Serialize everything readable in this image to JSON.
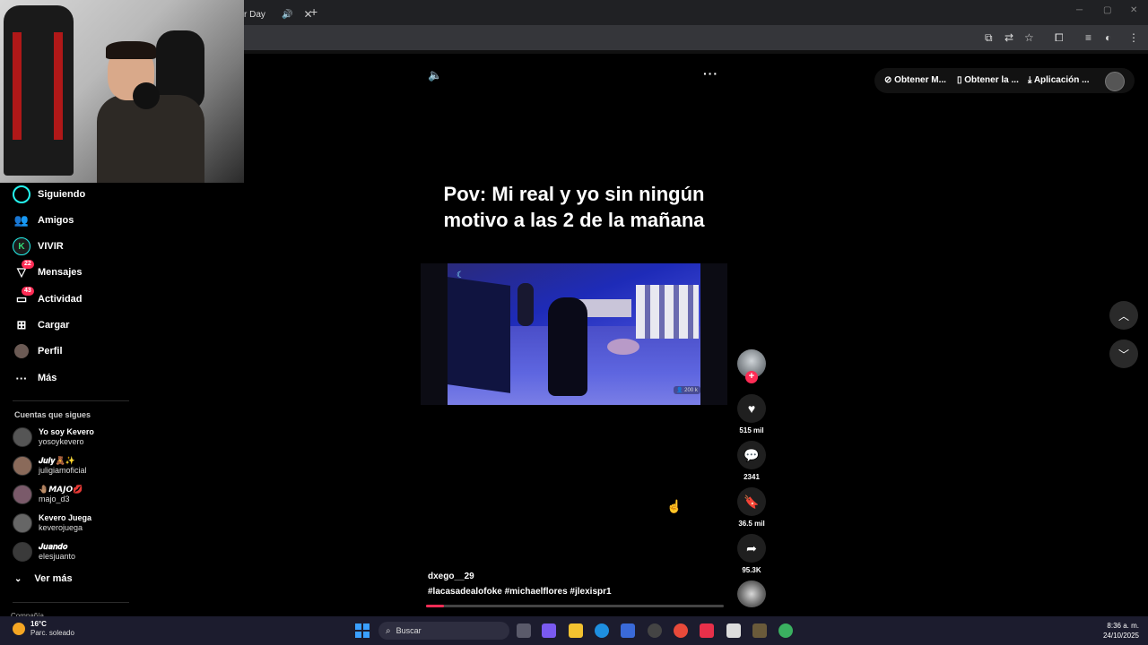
{
  "browser": {
    "tab_title": "r Day",
    "tab_audio_icon": "speaker-icon",
    "tab_close": "✕",
    "new_tab": "+"
  },
  "sidebar": {
    "items": [
      {
        "label": "Siguiendo",
        "icon": "following-icon"
      },
      {
        "label": "Amigos",
        "icon": "friends-icon"
      },
      {
        "label": "VIVIR",
        "icon": "live-icon",
        "glyph": "K"
      },
      {
        "label": "Mensajes",
        "icon": "messages-icon",
        "badge": "22"
      },
      {
        "label": "Actividad",
        "icon": "activity-icon",
        "badge": "43"
      },
      {
        "label": "Cargar",
        "icon": "upload-icon"
      },
      {
        "label": "Perfil",
        "icon": "profile-icon"
      },
      {
        "label": "Más",
        "icon": "more-icon"
      }
    ],
    "following_title": "Cuentas que sigues",
    "following": [
      {
        "name": "Yo soy Kevero",
        "username": "yosoykevero"
      },
      {
        "name": "𝑱𝒖𝒍𝒚🧸✨",
        "username": "juligiamoficial"
      },
      {
        "name": "🤚🏽𝙈𝘼𝙅𝙊💋",
        "username": "majo_d3"
      },
      {
        "name": "Kevero Juega",
        "username": "keverojuega"
      },
      {
        "name": "𝑱𝒖𝒂𝒏𝒅𝒐",
        "username": "elesjuanto"
      }
    ],
    "see_more": "Ver más",
    "cut_label": "Compañía"
  },
  "video": {
    "caption": "Pov: Mi real y yo sin ningún motivo a las 2 de la mañana",
    "view_count": "200 k",
    "author": "dxego__29",
    "hashtags": "#lacasadealofoke #michaelflores #jlexispr1",
    "progress": 0.06
  },
  "actions": {
    "likes": "515 mil",
    "comments": "2341",
    "saves": "36.5 mil",
    "shares": "95.3K"
  },
  "top_right": {
    "btn1": "Obtener M...",
    "btn2": "Obtener la ...",
    "btn3": "Aplicación ..."
  },
  "taskbar": {
    "temperature": "16°C",
    "weather": "Parc. soleado",
    "search_placeholder": "Buscar",
    "time": "8:36 a. m.",
    "date": "24/10/2025"
  },
  "colors": {
    "accent": "#fe2c55",
    "background": "#000000"
  }
}
